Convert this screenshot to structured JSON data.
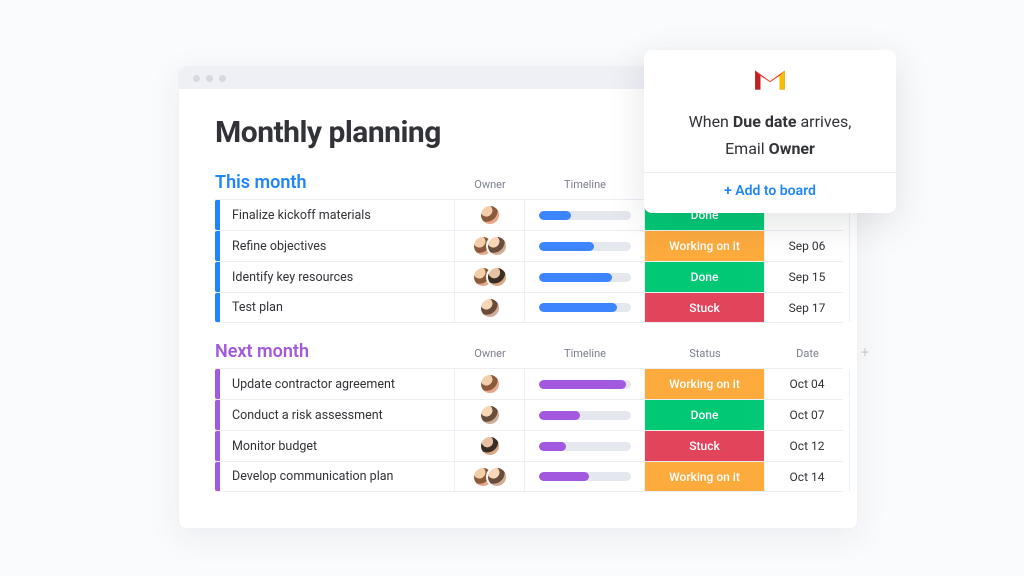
{
  "page_title": "Monthly planning",
  "columns": {
    "owner": "Owner",
    "timeline": "Timeline",
    "status": "Status",
    "date": "Date",
    "plus": "+"
  },
  "status_labels": {
    "done": "Done",
    "working": "Working on it",
    "stuck": "Stuck"
  },
  "sections": [
    {
      "title": "This month",
      "color": "blue",
      "rows": [
        {
          "task": "Finalize kickoff materials",
          "owners": [
            "av1"
          ],
          "progress": 35,
          "status": "done",
          "date": ""
        },
        {
          "task": "Refine objectives",
          "owners": [
            "av1",
            "av2"
          ],
          "progress": 60,
          "status": "working",
          "date": "Sep 06"
        },
        {
          "task": "Identify key resources",
          "owners": [
            "av1",
            "av3"
          ],
          "progress": 80,
          "status": "done",
          "date": "Sep 15"
        },
        {
          "task": "Test plan",
          "owners": [
            "av2"
          ],
          "progress": 85,
          "status": "stuck",
          "date": "Sep 17"
        }
      ]
    },
    {
      "title": "Next month",
      "color": "purple",
      "rows": [
        {
          "task": "Update contractor agreement",
          "owners": [
            "av1"
          ],
          "progress": 95,
          "status": "working",
          "date": "Oct 04"
        },
        {
          "task": "Conduct a risk assessment",
          "owners": [
            "av2"
          ],
          "progress": 45,
          "status": "done",
          "date": "Oct 07"
        },
        {
          "task": "Monitor budget",
          "owners": [
            "av3"
          ],
          "progress": 30,
          "status": "stuck",
          "date": "Oct 12"
        },
        {
          "task": "Develop communication plan",
          "owners": [
            "av1",
            "av2"
          ],
          "progress": 55,
          "status": "working",
          "date": "Oct 14"
        }
      ]
    }
  ],
  "automation": {
    "line1_prefix": "When ",
    "line1_bold": "Due date",
    "line1_suffix": " arrives,",
    "line2_prefix": "Email ",
    "line2_bold": "Owner",
    "add_label": "+ Add to board"
  }
}
